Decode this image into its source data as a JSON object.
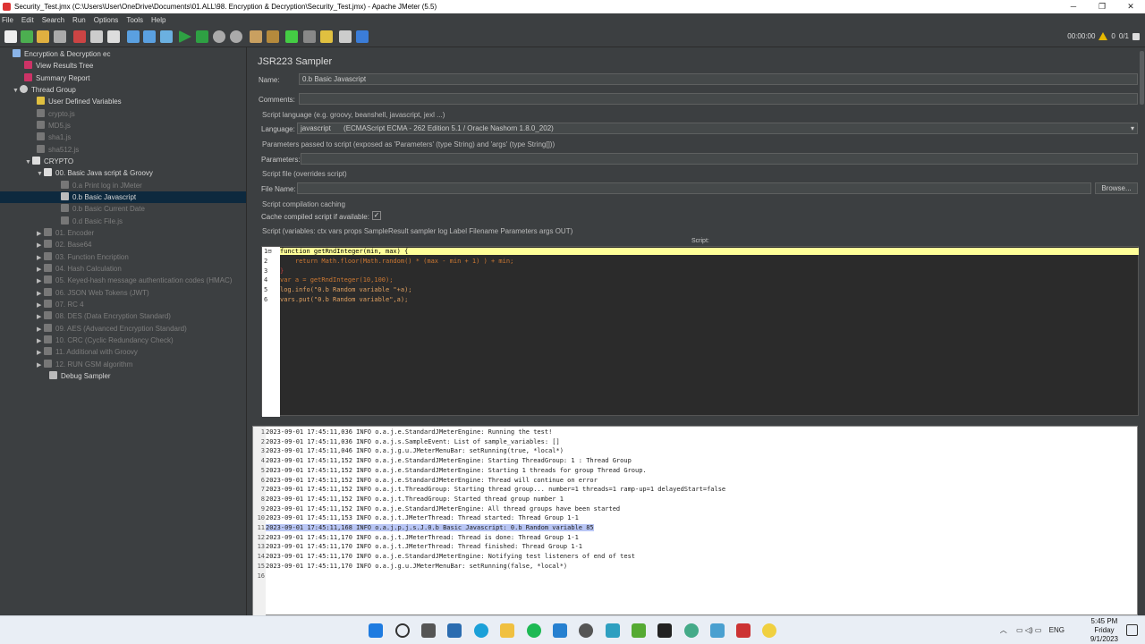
{
  "window": {
    "title": "Security_Test.jmx (C:\\Users\\User\\OneDrive\\Documents\\01.ALL\\98. Encryption & Decryption\\Security_Test.jmx) - Apache JMeter (5.5)"
  },
  "menu": [
    "File",
    "Edit",
    "Search",
    "Run",
    "Options",
    "Tools",
    "Help"
  ],
  "status": {
    "timer": "00:00:00",
    "warnings": "0",
    "threads": "0/1"
  },
  "tree": [
    {
      "label": "Encryption & Decryption ec",
      "dim": false
    },
    {
      "label": "View Results Tree",
      "dim": false
    },
    {
      "label": "Summary Report",
      "dim": false
    },
    {
      "label": "Thread Group",
      "dim": false
    },
    {
      "label": "User Defined Variables",
      "dim": false
    },
    {
      "label": "crypto.js",
      "dim": true
    },
    {
      "label": "MD5.js",
      "dim": true
    },
    {
      "label": "sha1.js",
      "dim": true
    },
    {
      "label": "sha512.js",
      "dim": true
    },
    {
      "label": "CRYPTO",
      "dim": false
    },
    {
      "label": "00. Basic Java script & Groovy",
      "dim": false
    },
    {
      "label": "0.a Print log in JMeter",
      "dim": true
    },
    {
      "label": "0.b Basic Javascript",
      "dim": false
    },
    {
      "label": "0.b Basic Current Date",
      "dim": true
    },
    {
      "label": "0.d Basic File.js",
      "dim": true
    },
    {
      "label": "01. Encoder",
      "dim": true
    },
    {
      "label": "02. Base64",
      "dim": true
    },
    {
      "label": "03. Function Encription",
      "dim": true
    },
    {
      "label": "04. Hash Calculation",
      "dim": true
    },
    {
      "label": "05. Keyed-hash message authentication codes (HMAC)",
      "dim": true
    },
    {
      "label": "06. JSON Web Tokens (JWT)",
      "dim": true
    },
    {
      "label": "07. RC 4",
      "dim": true
    },
    {
      "label": "08. DES (Data Encryption Standard)",
      "dim": true
    },
    {
      "label": "09. AES (Advanced Encryption Standard)",
      "dim": true
    },
    {
      "label": "10. CRC (Cyclic Redundancy Check)",
      "dim": true
    },
    {
      "label": "11. Additional with Groovy",
      "dim": true
    },
    {
      "label": "12. RUN GSM algorithm",
      "dim": true
    },
    {
      "label": "Debug Sampler",
      "dim": false
    }
  ],
  "sampler": {
    "heading": "JSR223 Sampler",
    "name_label": "Name:",
    "name_value": "0.b Basic Javascript",
    "comments_label": "Comments:",
    "lang_section": "Script language (e.g. groovy, beanshell, javascript, jexl ...)",
    "language_label": "Language:",
    "language_value": "javascript",
    "language_detail": "(ECMAScript ECMA - 262 Edition 5.1 / Oracle Nashorn 1.8.0_202)",
    "params_section": "Parameters passed to script (exposed as 'Parameters' (type String) and 'args' (type String[]))",
    "params_label": "Parameters:",
    "file_section": "Script file (overrides script)",
    "file_label": "File Name:",
    "browse": "Browse...",
    "cache_section": "Script compilation caching",
    "cache_label": "Cache compiled script if available:",
    "script_section": "Script (variables: ctx vars props SampleResult sampler log Label Filename Parameters args OUT)",
    "script_label": "Script:"
  },
  "code": [
    "function getRndInteger(min, max) {",
    "    return Math.floor(Math.random() * (max - min + 1) ) + min;",
    "}",
    "var a = getRndInteger(10,100);",
    "log.info(\"0.b Random variable \"+a);",
    "vars.put(\"0.b Random variable\",a);"
  ],
  "log": [
    "2023-09-01 17:45:11,036 INFO o.a.j.e.StandardJMeterEngine: Running the test!",
    "2023-09-01 17:45:11,036 INFO o.a.j.s.SampleEvent: List of sample_variables: []",
    "2023-09-01 17:45:11,046 INFO o.a.j.g.u.JMeterMenuBar: setRunning(true, *local*)",
    "2023-09-01 17:45:11,152 INFO o.a.j.e.StandardJMeterEngine: Starting ThreadGroup: 1 : Thread Group",
    "2023-09-01 17:45:11,152 INFO o.a.j.e.StandardJMeterEngine: Starting 1 threads for group Thread Group.",
    "2023-09-01 17:45:11,152 INFO o.a.j.e.StandardJMeterEngine: Thread will continue on error",
    "2023-09-01 17:45:11,152 INFO o.a.j.t.ThreadGroup: Starting thread group... number=1 threads=1 ramp-up=1 delayedStart=false",
    "2023-09-01 17:45:11,152 INFO o.a.j.t.ThreadGroup: Started thread group number 1",
    "2023-09-01 17:45:11,152 INFO o.a.j.e.StandardJMeterEngine: All thread groups have been started",
    "2023-09-01 17:45:11,153 INFO o.a.j.t.JMeterThread: Thread started: Thread Group 1-1",
    "2023-09-01 17:45:11,168 INFO o.a.j.p.j.s.J.0.b Basic Javascript: 0.b Random variable 85",
    "2023-09-01 17:45:11,170 INFO o.a.j.t.JMeterThread: Thread is done: Thread Group 1-1",
    "2023-09-01 17:45:11,170 INFO o.a.j.t.JMeterThread: Thread finished: Thread Group 1-1",
    "2023-09-01 17:45:11,170 INFO o.a.j.e.StandardJMeterEngine: Notifying test listeners of end of test",
    "2023-09-01 17:45:11,170 INFO o.a.j.g.u.JMeterMenuBar: setRunning(false, *local*)",
    ""
  ],
  "taskbar": {
    "lang": "ENG",
    "time": "5:45 PM",
    "day": "Friday",
    "date": "9/1/2023"
  }
}
